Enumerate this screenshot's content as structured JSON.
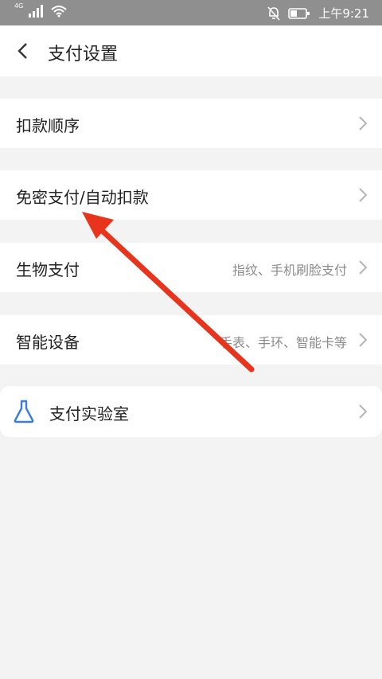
{
  "status_bar": {
    "network": "4G",
    "time": "上午9:21",
    "icons": [
      "signal-icon",
      "wifi-icon",
      "bell-off-icon",
      "battery-icon"
    ]
  },
  "header": {
    "title": "支付设置"
  },
  "settings": {
    "items": [
      {
        "label": "扣款顺序",
        "sub": ""
      },
      {
        "label": "免密支付/自动扣款",
        "sub": ""
      },
      {
        "label": "生物支付",
        "sub": "指纹、手机刷脸支付"
      },
      {
        "label": "智能设备",
        "sub": "手表、手环、智能卡等"
      }
    ]
  },
  "lab": {
    "label": "支付实验室",
    "icon": "flask-icon"
  },
  "colors": {
    "accent_blue": "#3a7be0",
    "annotation_red": "#e8341c"
  }
}
